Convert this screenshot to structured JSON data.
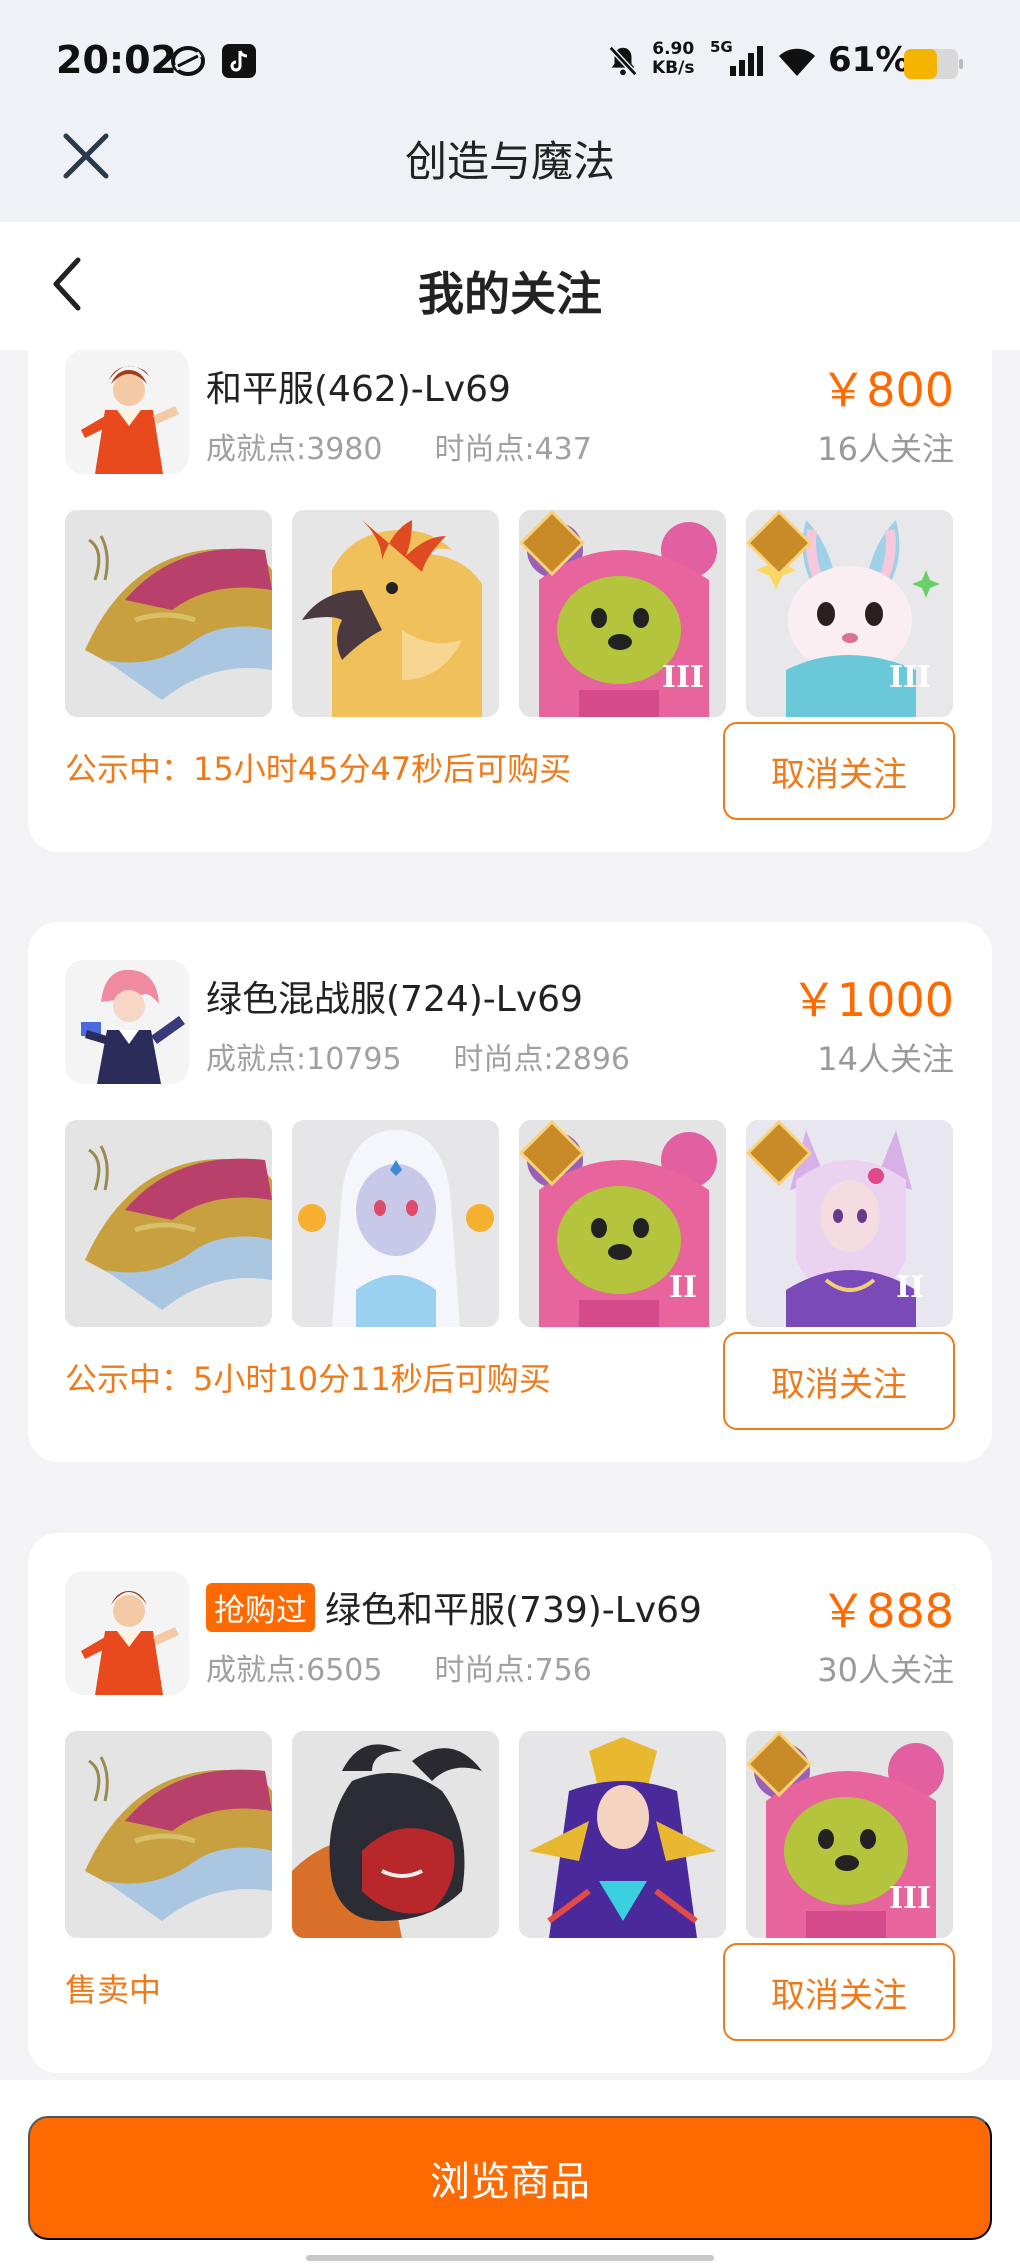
{
  "status_bar": {
    "time": "20:02",
    "net_speed": "6.90\nKB/s",
    "net_speed_top": "6.90",
    "net_speed_bottom": "KB/s",
    "network": "5G",
    "battery": "61%",
    "icons": [
      "loop-icon",
      "tiktok-icon",
      "mute-bell-icon",
      "signal-icon",
      "wifi-icon",
      "battery-icon"
    ]
  },
  "app_bar": {
    "title": "创造与魔法"
  },
  "header": {
    "title": "我的关注"
  },
  "cards": [
    {
      "name": "和平服(462)-Lv69",
      "badge": "",
      "achievement": "成就点:3980",
      "fashion": "时尚点:437",
      "price": "￥800",
      "followers": "16人关注",
      "status": "公示中：15小时45分47秒后可购买",
      "button": "取消关注",
      "items": [
        "dragon-mount",
        "golden-phoenix",
        "pink-bear-mount",
        "white-rabbit"
      ],
      "tiers": [
        "",
        "",
        "III",
        "III"
      ]
    },
    {
      "name": "绿色混战服(724)-Lv69",
      "badge": "",
      "achievement": "成就点:10795",
      "fashion": "时尚点:2896",
      "price": "￥1000",
      "followers": "14人关注",
      "status": "公示中：5小时10分11秒后可购买",
      "button": "取消关注",
      "items": [
        "dragon-mount",
        "ice-spirit",
        "pink-bear-mount",
        "fox-fairy"
      ],
      "tiers": [
        "",
        "",
        "II",
        "II"
      ]
    },
    {
      "name": "绿色和平服(739)-Lv69",
      "badge": "抢购过",
      "achievement": "成就点:6505",
      "fashion": "时尚点:756",
      "price": "￥888",
      "followers": "30人关注",
      "status": "售卖中",
      "button": "取消关注",
      "items": [
        "dragon-mount",
        "black-ram-beast",
        "golden-goddess",
        "pink-bear-mount"
      ],
      "tiers": [
        "",
        "",
        "",
        "III"
      ]
    }
  ],
  "bottom": {
    "browse_label": "浏览商品"
  },
  "colors": {
    "accent": "#ff6a00",
    "status_orange": "#f07a1a",
    "muted": "#a0a0a0"
  }
}
